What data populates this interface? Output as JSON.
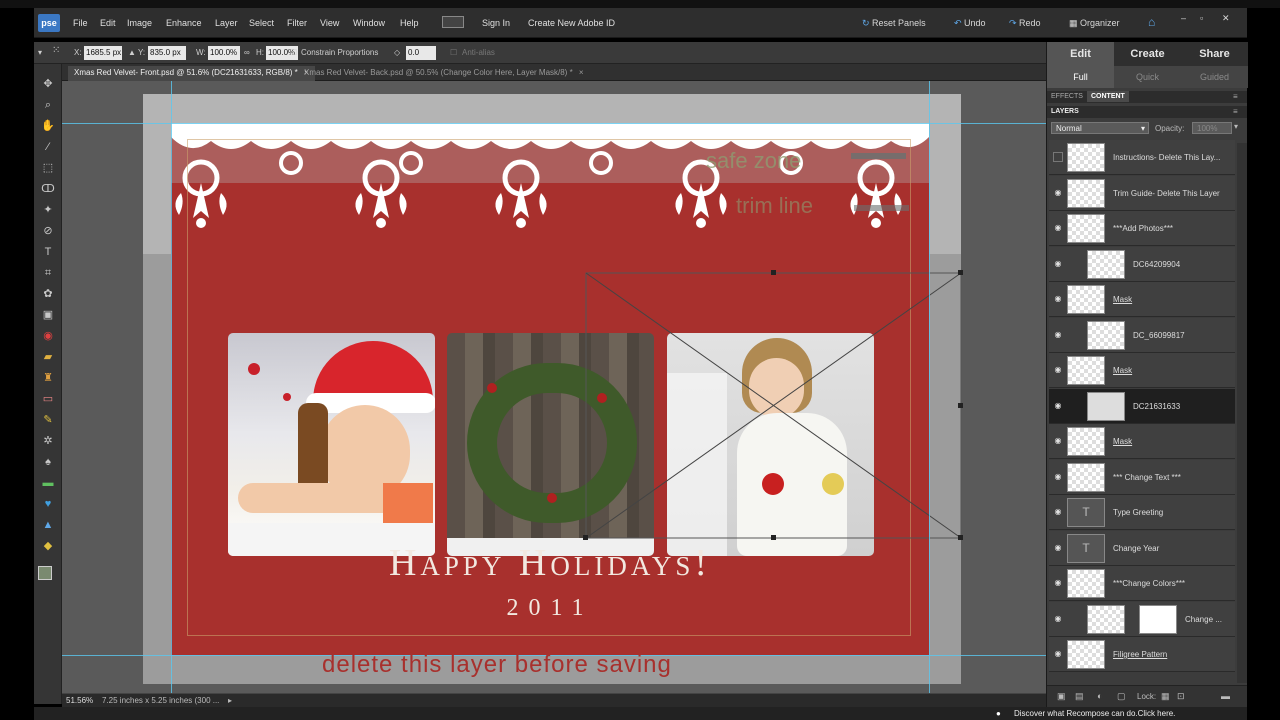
{
  "app": {
    "logo_text": "pse"
  },
  "menu": [
    "File",
    "Edit",
    "Image",
    "Enhance",
    "Layer",
    "Select",
    "Filter",
    "View",
    "Window",
    "Help"
  ],
  "top_actions": {
    "sign_in": "Sign In",
    "create_id": "Create New Adobe ID",
    "reset_panels": "Reset Panels",
    "undo": "Undo",
    "redo": "Redo",
    "organizer": "Organizer"
  },
  "window_controls": {
    "minimize": "–",
    "restore": "▫",
    "close": "✕"
  },
  "options": {
    "x_label": "X:",
    "x_value": "1685.5 px",
    "y_label": "Y:",
    "y_value": "835.0 px",
    "w_label": "W:",
    "w_value": "100.0%",
    "h_label": "H:",
    "h_value": "100.0%",
    "constrain": "Constrain Proportions",
    "angle_value": "0.0",
    "antialias": "Anti-alias"
  },
  "doc_tabs": [
    {
      "label": "Xmas Red Velvet- Front.psd @ 51.6% (DC21631633, RGB/8) *",
      "close": "×"
    },
    {
      "label": "Xmas Red Velvet- Back.psd @ 50.5% (Change Color Here, Layer Mask/8) *",
      "close": "×"
    }
  ],
  "card": {
    "greeting": "Happy Holidays!",
    "year": "2011",
    "safe_zone": "safe zone",
    "trim_line": "trim line",
    "delete_note": "delete this layer before saving"
  },
  "status": {
    "zoom": "51.56%",
    "doc_size": "7.25 inches x 5.25 inches (300 ..."
  },
  "bottom_hint": "Discover what Recompose can do.Click here.",
  "panel": {
    "tabs": [
      "Edit",
      "Create",
      "Share"
    ],
    "subtabs": [
      "Full",
      "Quick",
      "Guided"
    ],
    "panel_tabs": [
      "EFFECTS",
      "CONTENT"
    ],
    "layers_title": "LAYERS",
    "blend_mode": "Normal",
    "opacity_label": "Opacity:",
    "opacity_value": "100%",
    "lock_label": "Lock:",
    "layers": [
      {
        "name": "Instructions- Delete This Lay...",
        "visible": false,
        "selected": false,
        "underline": false
      },
      {
        "name": "Trim Guide- Delete This Layer",
        "visible": true,
        "selected": false,
        "underline": false
      },
      {
        "name": "***Add Photos***",
        "visible": true,
        "selected": false,
        "underline": false
      },
      {
        "name": "DC64209904",
        "visible": true,
        "selected": false,
        "underline": false
      },
      {
        "name": "Mask",
        "visible": true,
        "selected": false,
        "underline": true
      },
      {
        "name": "DC_66099817",
        "visible": true,
        "selected": false,
        "underline": false
      },
      {
        "name": "Mask",
        "visible": true,
        "selected": false,
        "underline": true
      },
      {
        "name": "DC21631633",
        "visible": true,
        "selected": true,
        "underline": false
      },
      {
        "name": "Mask",
        "visible": true,
        "selected": false,
        "underline": true
      },
      {
        "name": "*** Change Text ***",
        "visible": true,
        "selected": false,
        "underline": false
      },
      {
        "name": "Type Greeting",
        "visible": true,
        "selected": false,
        "underline": false
      },
      {
        "name": "Change Year",
        "visible": true,
        "selected": false,
        "underline": false
      },
      {
        "name": "***Change Colors***",
        "visible": true,
        "selected": false,
        "underline": false
      },
      {
        "name": "Change ...",
        "visible": true,
        "selected": false,
        "underline": false
      },
      {
        "name": "Filigree Pattern",
        "visible": true,
        "selected": false,
        "underline": true
      }
    ]
  }
}
